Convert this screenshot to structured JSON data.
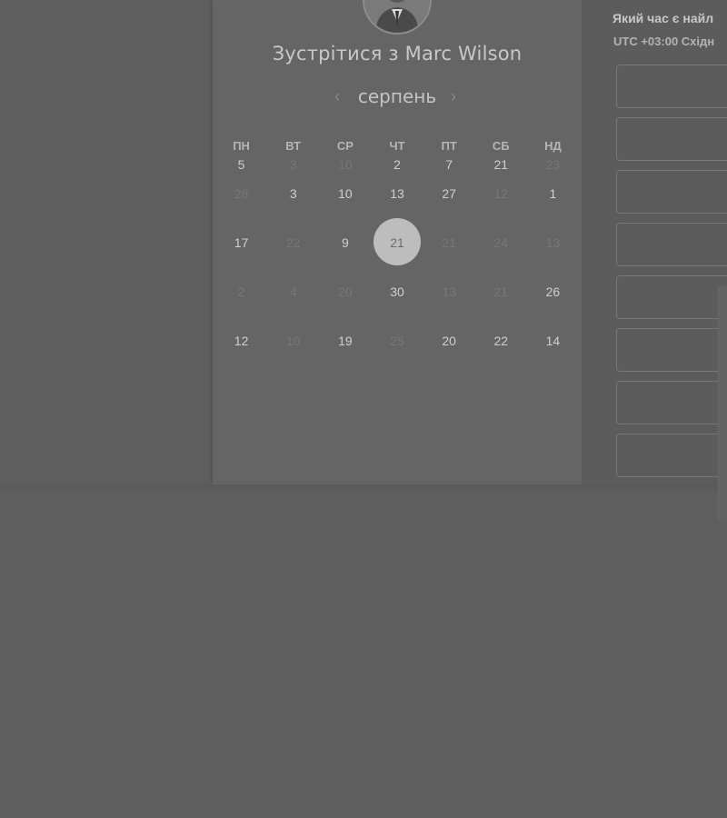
{
  "header": {
    "title": "Зустрітися з Marc Wilson",
    "avatar_icon": "person-avatar-icon"
  },
  "calendar": {
    "month": "серпень",
    "prev_icon": "‹",
    "next_icon": "›",
    "weekdays": [
      "ПН",
      "ВТ",
      "СР",
      "ЧТ",
      "ПТ",
      "СБ",
      "НД"
    ],
    "weeks": [
      [
        {
          "d": "5",
          "avail": true
        },
        {
          "d": "3",
          "avail": false
        },
        {
          "d": "10",
          "avail": false
        },
        {
          "d": "2",
          "avail": true
        },
        {
          "d": "7",
          "avail": true
        },
        {
          "d": "21",
          "avail": true
        },
        {
          "d": "23",
          "avail": false
        }
      ],
      [
        {
          "d": "28",
          "avail": false
        },
        {
          "d": "3",
          "avail": true
        },
        {
          "d": "10",
          "avail": true
        },
        {
          "d": "13",
          "avail": true
        },
        {
          "d": "27",
          "avail": true
        },
        {
          "d": "12",
          "avail": false
        },
        {
          "d": "1",
          "avail": true
        }
      ],
      [
        {
          "d": "17",
          "avail": true
        },
        {
          "d": "22",
          "avail": false
        },
        {
          "d": "9",
          "avail": true
        },
        {
          "d": "21",
          "avail": true,
          "selected": true
        },
        {
          "d": "21",
          "avail": false
        },
        {
          "d": "24",
          "avail": false
        },
        {
          "d": "13",
          "avail": false
        }
      ],
      [
        {
          "d": "2",
          "avail": false
        },
        {
          "d": "4",
          "avail": false
        },
        {
          "d": "20",
          "avail": false
        },
        {
          "d": "30",
          "avail": true
        },
        {
          "d": "13",
          "avail": false
        },
        {
          "d": "21",
          "avail": false
        },
        {
          "d": "26",
          "avail": true
        }
      ],
      [
        {
          "d": "12",
          "avail": true
        },
        {
          "d": "10",
          "avail": false
        },
        {
          "d": "19",
          "avail": true
        },
        {
          "d": "25",
          "avail": false
        },
        {
          "d": "20",
          "avail": true
        },
        {
          "d": "22",
          "avail": true
        },
        {
          "d": "14",
          "avail": true
        }
      ]
    ]
  },
  "times": {
    "question": "Який час є найл",
    "timezone": "UTC +03:00 Східн",
    "slot_count": 8
  },
  "colors": {
    "background": "#5e5e5e",
    "card": "#656565",
    "selected_day": "#bdbdbd"
  }
}
